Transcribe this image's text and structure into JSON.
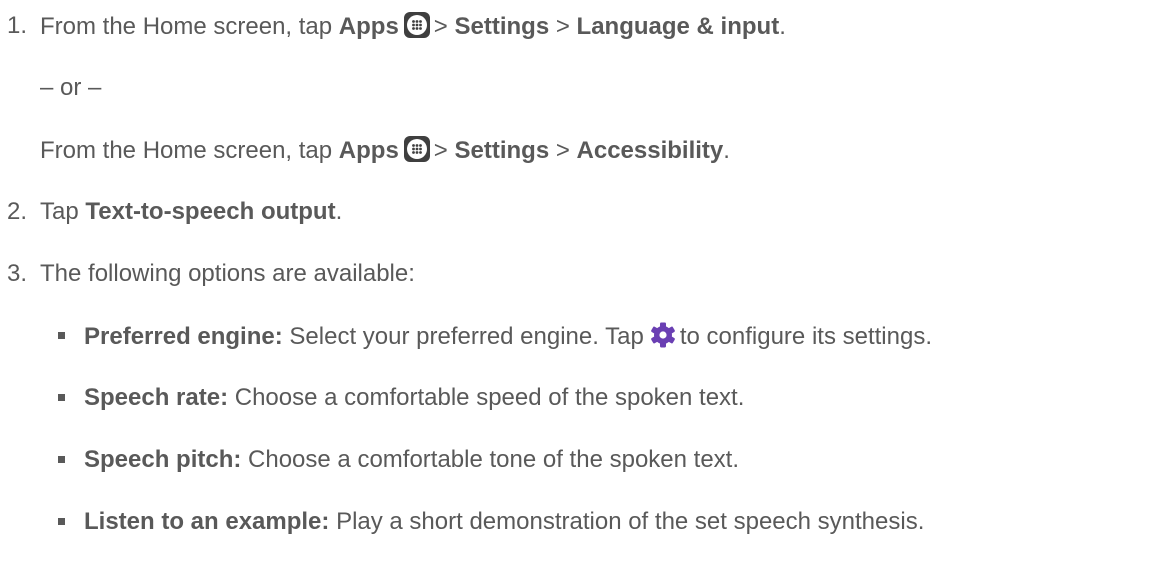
{
  "steps": [
    {
      "number": "1.",
      "prefix": "From the Home screen, tap",
      "apps": "Apps",
      "sep1": ">",
      "settings": "Settings",
      "sep2": ">",
      "target": "Language & input",
      "end": "."
    },
    {
      "or": "– or –"
    },
    {
      "prefix": "From the Home screen, tap",
      "apps": "Apps",
      "sep1": ">",
      "settings": "Settings",
      "sep2": ">",
      "target": "Accessibility",
      "end": "."
    },
    {
      "number": "2.",
      "prefix": "Tap",
      "target": "Text-to-speech output",
      "end": "."
    },
    {
      "number": "3.",
      "text": "The following options are available:"
    }
  ],
  "options": [
    {
      "term": "Preferred engine:",
      "before_icon": "Select your preferred engine. Tap",
      "after_icon": "to configure its settings."
    },
    {
      "term": "Speech rate:",
      "desc": "Choose a comfortable speed of the spoken text."
    },
    {
      "term": "Speech pitch:",
      "desc": "Choose a comfortable tone of the spoken text."
    },
    {
      "term": "Listen to an example:",
      "desc": "Play a short demonstration of the set speech synthesis."
    }
  ],
  "colors": {
    "text": "#595959",
    "apps_icon_bg": "#3f3f3f",
    "gear_icon": "#6a3fb3"
  },
  "icons": {
    "apps": "apps-grid-icon",
    "settings": "gear-icon"
  }
}
